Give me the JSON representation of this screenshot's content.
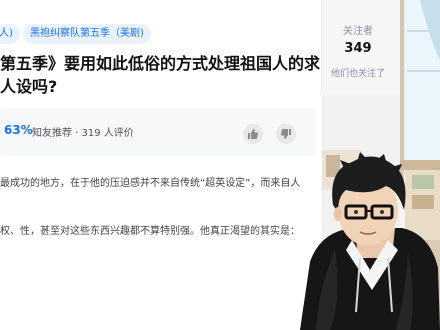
{
  "tags": [
    "人)",
    "黑袍纠察队第五季（美剧)"
  ],
  "question": {
    "title_line1": "第五季》要用如此低俗的方式处理祖国人的求",
    "title_line2": "人设吗?"
  },
  "follow": {
    "label": "关注者",
    "count": "349",
    "subtitle": "他们也关注了"
  },
  "summary": {
    "percent": "63%",
    "meta": "知友推荐 · 319 人评价"
  },
  "body": {
    "line1": "最成功的地方，在于他的压迫感并不来自传统“超英设定”，而来自人",
    "line2": "权、性，甚至对这些东西兴趣都不算特别强。他真正渴望的其实是："
  }
}
